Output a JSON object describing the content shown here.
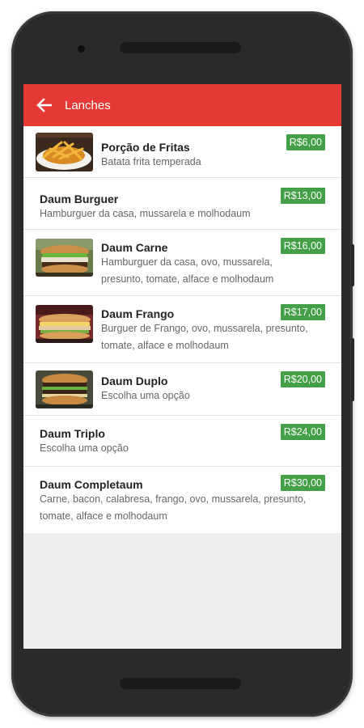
{
  "header": {
    "title": "Lanches",
    "back_icon": "arrow-left-icon"
  },
  "colors": {
    "appbar": "#e53935",
    "price_badge": "#43a047"
  },
  "items": [
    {
      "name": "Porção de Fritas",
      "description": "Batata frita temperada",
      "price": "R$6,00",
      "has_image": true,
      "image": "fries-photo"
    },
    {
      "name": "Daum Burguer",
      "description": "Hamburguer da casa, mussarela e molhodaum",
      "price": "R$13,00",
      "has_image": false
    },
    {
      "name": "Daum Carne",
      "description": "Hamburguer da casa, ovo, mussarela, presunto, tomate, alface e molhodaum",
      "price": "R$16,00",
      "has_image": true,
      "image": "burger-photo"
    },
    {
      "name": "Daum Frango",
      "description": "Burguer de Frango, ovo, mussarela, presunto, tomate, alface e molhodaum",
      "price": "R$17,00",
      "has_image": true,
      "image": "chicken-burger-photo"
    },
    {
      "name": "Daum Duplo",
      "description": "Escolha uma opção",
      "price": "R$20,00",
      "has_image": true,
      "image": "double-burger-photo"
    },
    {
      "name": "Daum Triplo",
      "description": "Escolha uma opção",
      "price": "R$24,00",
      "has_image": false
    },
    {
      "name": "Daum Completaum",
      "description": "Carne, bacon, calabresa, frango, ovo, mussarela, presunto, tomate, alface e molhodaum",
      "price": "R$30,00",
      "has_image": false
    }
  ]
}
